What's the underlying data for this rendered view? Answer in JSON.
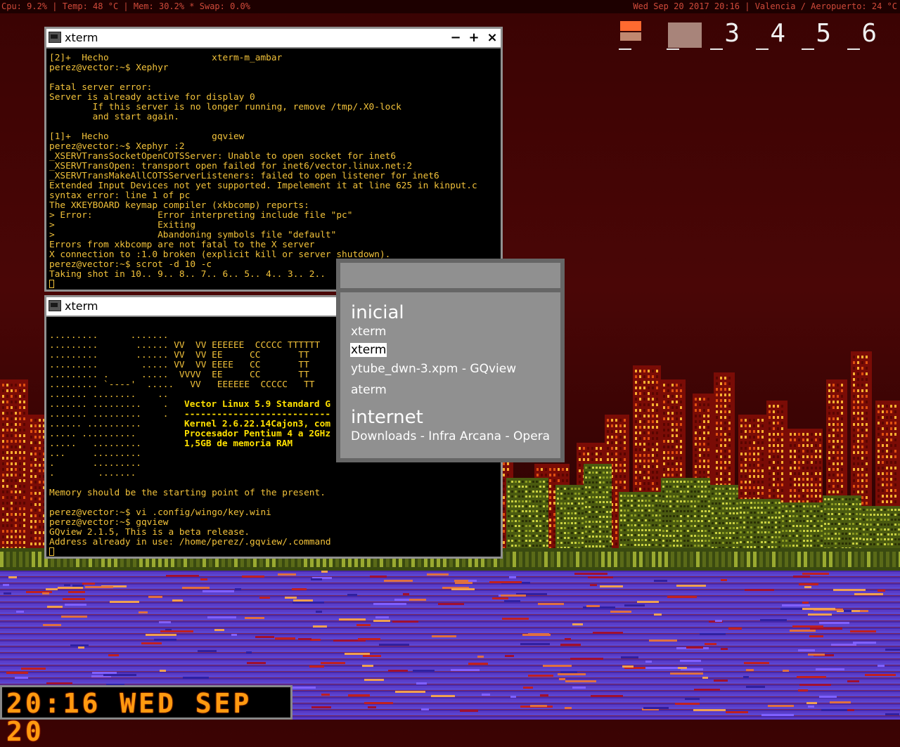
{
  "statusbar": {
    "left": "Cpu: 9.2% | Temp: 48 °C | Mem: 30.2% * Swap: 0.0%",
    "right": "Wed Sep 20 2017 20:16 | Valencia / Aeropuerto: 24 °C"
  },
  "pager": {
    "workspaces": [
      "",
      "",
      "3",
      "4",
      "5",
      "6"
    ],
    "active_color": "#a8847a",
    "first_color": "#ff6a30"
  },
  "xterm1": {
    "title": "xterm",
    "lines": [
      "[2]+  Hecho                   xterm-m_ambar",
      "perez@vector:~$ Xephyr",
      "",
      "Fatal server error:",
      "Server is already active for display 0",
      "        If this server is no longer running, remove /tmp/.X0-lock",
      "        and start again.",
      "",
      "[1]+  Hecho                   gqview",
      "perez@vector:~$ Xephyr :2",
      "_XSERVTransSocketOpenCOTSServer: Unable to open socket for inet6",
      "_XSERVTransOpen: transport open failed for inet6/vector.linux.net:2",
      "_XSERVTransMakeAllCOTSServerListeners: failed to open listener for inet6",
      "Extended Input Devices not yet supported. Impelement it at line 625 in kinput.c",
      "syntax error: line 1 of pc",
      "The XKEYBOARD keymap compiler (xkbcomp) reports:",
      "> Error:            Error interpreting include file \"pc\"",
      ">                   Exiting",
      ">                   Abandoning symbols file \"default\"",
      "Errors from xkbcomp are not fatal to the X server",
      "X connection to :1.0 broken (explicit kill or server shutdown).",
      "perez@vector:~$ scrot -d 10 -c",
      "Taking shot in 10.. 9.. 8.. 7.. 6.. 5.. 4.. 3.. 2.."
    ]
  },
  "xterm2": {
    "title": "xterm",
    "lines": [
      "",
      ".........      .......",
      ".........       ...... VV  VV EEEEEE  CCCCC TTTTTT",
      ".........       ...... VV  VV EE     CC       TT",
      ".........        ..... VV  VV EEEE   CC       TT",
      "......... .      .....  VVVV  EE     CC       TT",
      "......... `----'  .....   VV   EEEEEE  CCCCC   TT",
      "....... ........    ..",
      "....... .........    .",
      "....... .........    .",
      "...... ..........",
      "..... ..........",
      ".....   .........",
      "...     .........",
      ".       .........",
      ".        .......",
      "",
      "Memory should be the starting point of the present.",
      "",
      "perez@vector:~$ vi .config/wingo/key.wini",
      "perez@vector:~$ gqview",
      "GQview 2.1.5, This is a beta release.",
      "Address already in use: /home/perez/.gqview/.command"
    ],
    "info": [
      "Vector Linux 5.9 Standard G",
      "---------------------------",
      "Kernel 2.6.22.14Cajon3, com",
      "Procesador Pentium 4 a 2GHz",
      "1,5GB de memoria RAM"
    ]
  },
  "switcher": {
    "groups": [
      {
        "name": "inicial",
        "items": [
          "xterm",
          "xterm",
          "ytube_dwn-3.xpm - GQview",
          "aterm"
        ]
      },
      {
        "name": "internet",
        "items": [
          "Downloads - Infra Arcana - Opera"
        ]
      }
    ],
    "selected_index": 1
  },
  "clock": {
    "text": "20:16 WED SEP 20"
  }
}
